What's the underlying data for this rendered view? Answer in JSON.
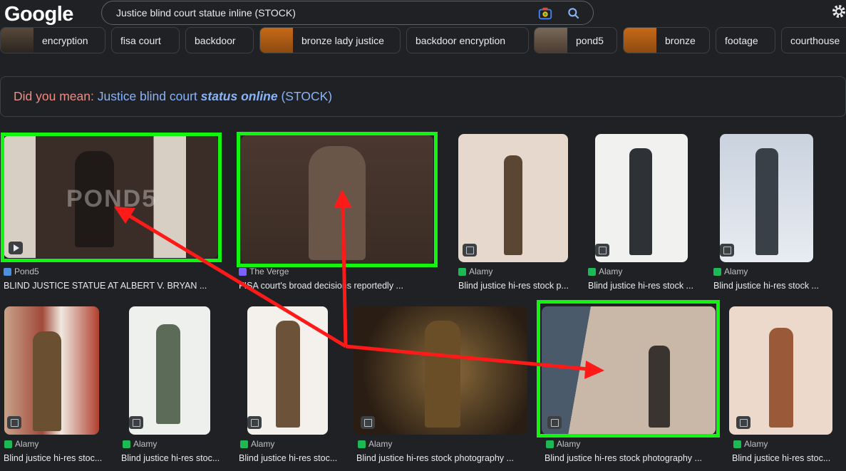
{
  "header": {
    "logo": "Google",
    "query": "Justice blind court statue inline (STOCK)"
  },
  "chips": [
    {
      "label": "encryption",
      "thumb": true
    },
    {
      "label": "fisa court",
      "thumb": false
    },
    {
      "label": "backdoor",
      "thumb": false
    },
    {
      "label": "bronze lady justice",
      "thumb": true
    },
    {
      "label": "backdoor encryption",
      "thumb": false
    },
    {
      "label": "pond5",
      "thumb": true
    },
    {
      "label": "bronze",
      "thumb": true
    },
    {
      "label": "footage",
      "thumb": false
    },
    {
      "label": "courthouse",
      "thumb": false
    }
  ],
  "did_you_mean": {
    "prefix": "Did you mean:",
    "part1": "Justice blind court",
    "emphasis": "status online",
    "part2": "(STOCK)"
  },
  "results_row1": [
    {
      "source": "Pond5",
      "title": "BLIND JUSTICE STATUE AT ALBERT V. BRYAN ...",
      "watermark": "POND5"
    },
    {
      "source": "The Verge",
      "title": "FISA court's broad decisions reportedly ..."
    },
    {
      "source": "Alamy",
      "title": "Blind justice hi-res stock p..."
    },
    {
      "source": "Alamy",
      "title": "Blind justice hi-res stock ..."
    },
    {
      "source": "Alamy",
      "title": "Blind justice hi-res stock ..."
    }
  ],
  "results_row2": [
    {
      "source": "Alamy",
      "title": "Blind justice hi-res stoc..."
    },
    {
      "source": "Alamy",
      "title": "Blind justice hi-res stoc..."
    },
    {
      "source": "Alamy",
      "title": "Blind justice hi-res stoc..."
    },
    {
      "source": "Alamy",
      "title": "Blind justice hi-res stock photography ..."
    },
    {
      "source": "Alamy",
      "title": "Blind justice hi-res stock photography ..."
    },
    {
      "source": "Alamy",
      "title": "Blind justice hi-res stoc..."
    }
  ],
  "colors": {
    "highlight": "#11f511",
    "arrow": "#ff1a1a",
    "link": "#8ab4f8",
    "suggest": "#f28b82"
  }
}
